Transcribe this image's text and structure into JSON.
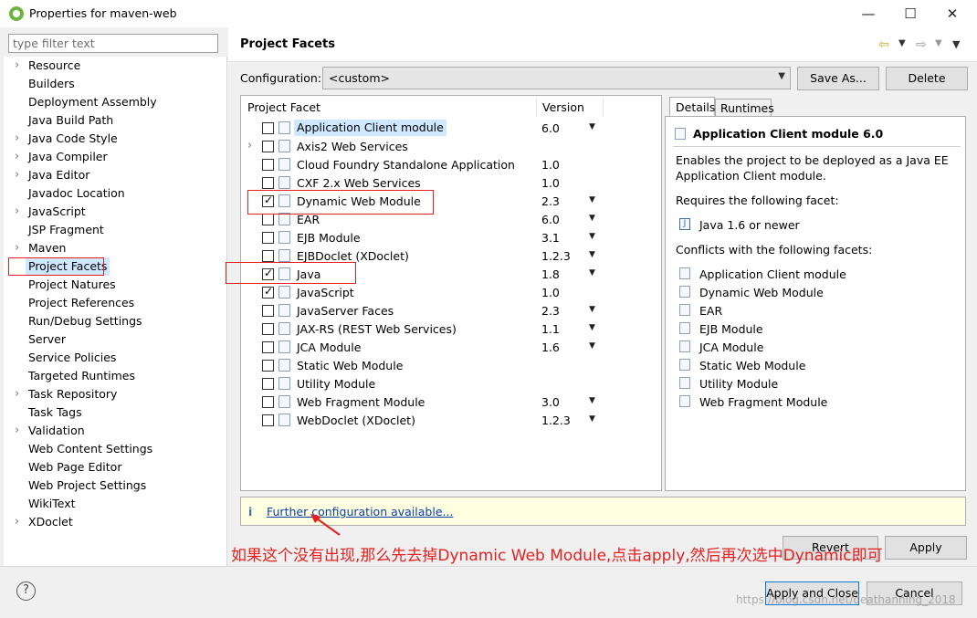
{
  "window": {
    "title": "Properties for maven-web",
    "controls": {
      "minimize": "—",
      "maximize": "☐",
      "close": "✕"
    }
  },
  "left": {
    "filter_placeholder": "type filter text",
    "tree": [
      {
        "label": "Resource",
        "expandable": true
      },
      {
        "label": "Builders",
        "expandable": false
      },
      {
        "label": "Deployment Assembly",
        "expandable": false
      },
      {
        "label": "Java Build Path",
        "expandable": false
      },
      {
        "label": "Java Code Style",
        "expandable": true
      },
      {
        "label": "Java Compiler",
        "expandable": true
      },
      {
        "label": "Java Editor",
        "expandable": true
      },
      {
        "label": "Javadoc Location",
        "expandable": false
      },
      {
        "label": "JavaScript",
        "expandable": true
      },
      {
        "label": "JSP Fragment",
        "expandable": false
      },
      {
        "label": "Maven",
        "expandable": true
      },
      {
        "label": "Project Facets",
        "expandable": false,
        "selected": true
      },
      {
        "label": "Project Natures",
        "expandable": false
      },
      {
        "label": "Project References",
        "expandable": false
      },
      {
        "label": "Run/Debug Settings",
        "expandable": false
      },
      {
        "label": "Server",
        "expandable": false
      },
      {
        "label": "Service Policies",
        "expandable": false
      },
      {
        "label": "Targeted Runtimes",
        "expandable": false
      },
      {
        "label": "Task Repository",
        "expandable": true
      },
      {
        "label": "Task Tags",
        "expandable": false
      },
      {
        "label": "Validation",
        "expandable": true
      },
      {
        "label": "Web Content Settings",
        "expandable": false
      },
      {
        "label": "Web Page Editor",
        "expandable": false
      },
      {
        "label": "Web Project Settings",
        "expandable": false
      },
      {
        "label": "WikiText",
        "expandable": false
      },
      {
        "label": "XDoclet",
        "expandable": true
      }
    ]
  },
  "right": {
    "title": "Project Facets",
    "configuration_label": "Configuration:",
    "configuration_value": "<custom>",
    "save_as": "Save As...",
    "delete": "Delete",
    "table_headers": {
      "facet": "Project Facet",
      "version": "Version"
    },
    "facets": [
      {
        "name": "Application Client module",
        "version": "6.0",
        "checked": false,
        "dropdown": true,
        "selected": true,
        "expandable": false
      },
      {
        "name": "Axis2 Web Services",
        "version": "",
        "checked": false,
        "dropdown": false,
        "expandable": true
      },
      {
        "name": "Cloud Foundry Standalone Application",
        "version": "1.0",
        "checked": false,
        "dropdown": false,
        "expandable": false
      },
      {
        "name": "CXF 2.x Web Services",
        "version": "1.0",
        "checked": false,
        "dropdown": false,
        "expandable": false
      },
      {
        "name": "Dynamic Web Module",
        "version": "2.3",
        "checked": true,
        "dropdown": true,
        "expandable": false
      },
      {
        "name": "EAR",
        "version": "6.0",
        "checked": false,
        "dropdown": true,
        "expandable": false
      },
      {
        "name": "EJB Module",
        "version": "3.1",
        "checked": false,
        "dropdown": true,
        "expandable": false
      },
      {
        "name": "EJBDoclet (XDoclet)",
        "version": "1.2.3",
        "checked": false,
        "dropdown": true,
        "expandable": false
      },
      {
        "name": "Java",
        "version": "1.8",
        "checked": true,
        "dropdown": true,
        "expandable": false
      },
      {
        "name": "JavaScript",
        "version": "1.0",
        "checked": true,
        "dropdown": false,
        "expandable": false
      },
      {
        "name": "JavaServer Faces",
        "version": "2.3",
        "checked": false,
        "dropdown": true,
        "expandable": false
      },
      {
        "name": "JAX-RS (REST Web Services)",
        "version": "1.1",
        "checked": false,
        "dropdown": true,
        "expandable": false
      },
      {
        "name": "JCA Module",
        "version": "1.6",
        "checked": false,
        "dropdown": true,
        "expandable": false
      },
      {
        "name": "Static Web Module",
        "version": "",
        "checked": false,
        "dropdown": false,
        "expandable": false
      },
      {
        "name": "Utility Module",
        "version": "",
        "checked": false,
        "dropdown": false,
        "expandable": false
      },
      {
        "name": "Web Fragment Module",
        "version": "3.0",
        "checked": false,
        "dropdown": true,
        "expandable": false
      },
      {
        "name": "WebDoclet (XDoclet)",
        "version": "1.2.3",
        "checked": false,
        "dropdown": true,
        "expandable": false
      }
    ],
    "tabs": {
      "details": "Details",
      "runtimes": "Runtimes"
    },
    "details": {
      "heading": "Application Client module 6.0",
      "description": [
        "Enables the project to be deployed as a Java EE",
        "Application Client module."
      ],
      "requires_label": "Requires the following facet:",
      "requires": [
        "Java 1.6 or newer"
      ],
      "conflicts_label": "Conflicts with the following facets:",
      "conflicts": [
        "Application Client module",
        "Dynamic Web Module",
        "EAR",
        "EJB Module",
        "JCA Module",
        "Static Web Module",
        "Utility Module",
        "Web Fragment Module"
      ]
    },
    "info_icon": "i",
    "further_link": "Further configuration available...",
    "revert": "Revert",
    "apply": "Apply"
  },
  "footer": {
    "help": "?",
    "apply_and_close": "Apply and Close",
    "cancel": "Cancel"
  },
  "annotation": {
    "text": "如果这个没有出现,那么先去掉Dynamic Web Module,点击apply,然后再次选中Dynamic即可",
    "color": "#e52020"
  },
  "watermark": "https://blog.csdn.net/deathanning_2018"
}
